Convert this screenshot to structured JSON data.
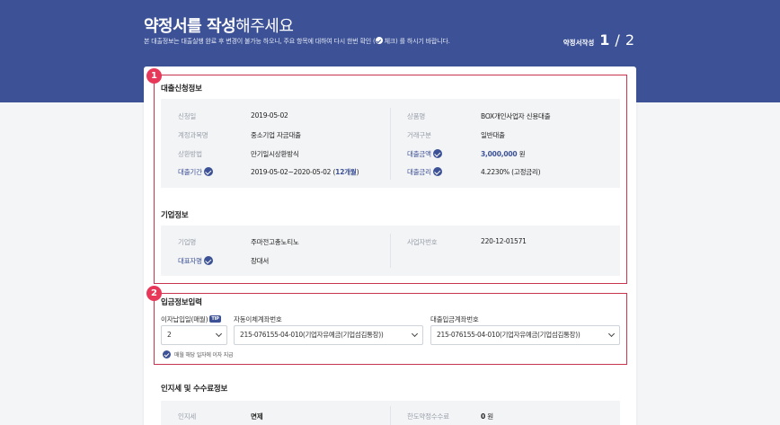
{
  "header": {
    "title_bold": "약정서를 작성",
    "title_light": "해주세요",
    "subtitle_before": "본 대출정보는 대출실행 완료 후 변경이 불가능 하오니, 주요 항목에 대하여 다시 한번 확인 (",
    "subtitle_after": " 체크) 를 하시기 바랍니다.",
    "step_label": "약정서작성",
    "step_current": "1",
    "step_sep": "/",
    "step_total": "2"
  },
  "markers": [
    "1",
    "2"
  ],
  "loan_info": {
    "title": "대출신청정보",
    "rows": [
      {
        "l1": "신청일",
        "v1": "2019-05-02",
        "l2": "상품명",
        "v2": "BOX개인사업자 신용대출"
      },
      {
        "l1": "계정과목명",
        "v1": "중소기업 자금대출",
        "l2": "거래구분",
        "v2": "일반대출"
      },
      {
        "l1": "상환방법",
        "v1": "만기일시상환방식",
        "l2": "대출금액",
        "v2_num": "3,000,000",
        "v2_unit": " 원"
      },
      {
        "l1": "대출기간",
        "v1_main": "2019-05-02~2020-05-02 (",
        "v1_blue": "12개월",
        "v1_end": ")",
        "l2": "대출금리",
        "v2": "4.2230% (고정금리)"
      }
    ]
  },
  "company_info": {
    "title": "기업정보",
    "rows": [
      {
        "l1": "기업명",
        "v1": "주마전고총노티노",
        "l2": "사업자번호",
        "v2": "220-12-01571"
      },
      {
        "l1": "대표자명",
        "v1": "장대서"
      }
    ]
  },
  "deposit_info": {
    "title": "입금정보입력",
    "interest_day_label": "이자납입일(매월)",
    "tip": "TIP",
    "interest_day_value": "2",
    "auto_transfer_label": "자동이체계좌번호",
    "auto_transfer_value": "215-076155-04-010(기업자유예금(기업섬김통장))",
    "deposit_account_label": "대출입금계좌번호",
    "deposit_account_value": "215-076155-04-010(기업자유예금(기업섬김통장))",
    "agree_text": "매월 해당 일자에 이자 지급"
  },
  "fee_info": {
    "title": "인지세 및 수수료정보",
    "l1": "인지세",
    "v1": "면제",
    "l2": "한도약정수수료",
    "v2_num": "0",
    "v2_unit": " 원"
  },
  "colors": {
    "brand": "#3d5296",
    "marker": "#e8385a"
  }
}
